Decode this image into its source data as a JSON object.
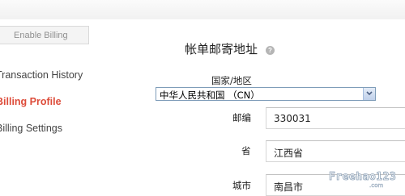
{
  "sidebar": {
    "enable_billing": "Enable Billing",
    "items": [
      {
        "label": "Transaction History"
      },
      {
        "label": "Billing Profile"
      },
      {
        "label": "Billing Settings"
      }
    ]
  },
  "main": {
    "title": "帐单邮寄地址",
    "country_label": "国家/地区",
    "country_value": "中华人民共和国 （CN）",
    "postcode_label": "邮编",
    "postcode_value": "330031",
    "province_label": "省",
    "province_value": "江西省",
    "city_label": "城市",
    "city_value": "南昌市"
  },
  "colors": {
    "active_nav": "#dd4b39",
    "field_border": "#d6d6d6"
  }
}
